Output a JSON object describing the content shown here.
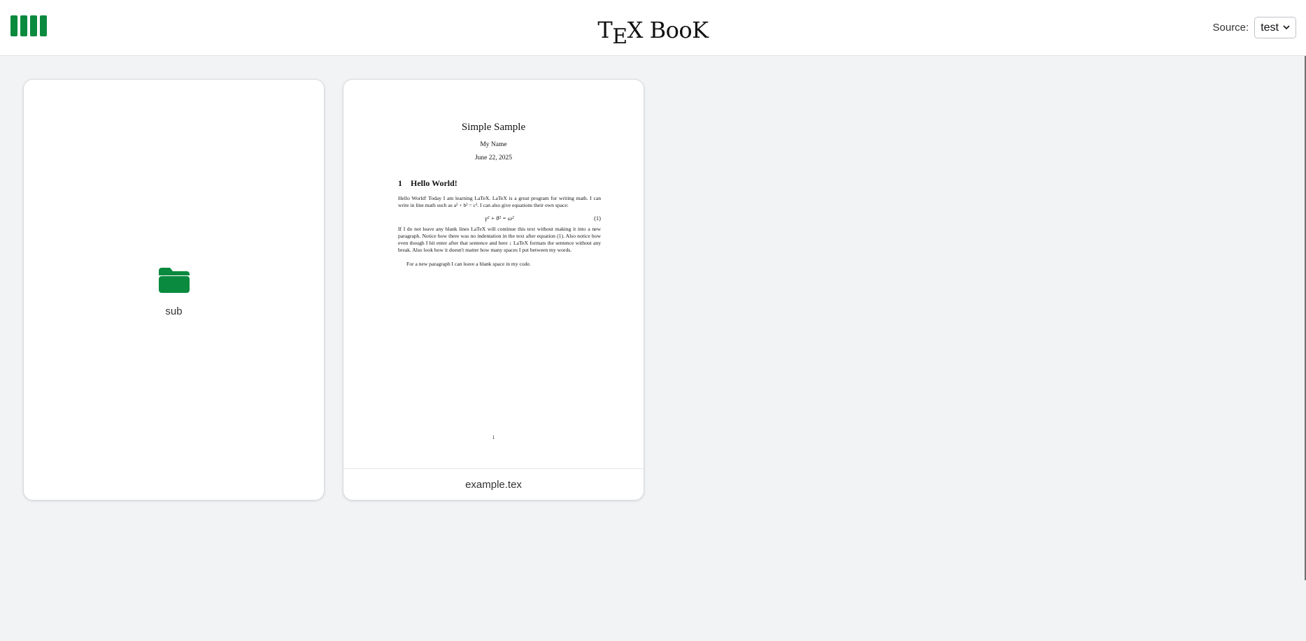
{
  "app": {
    "title_parts": {
      "t": "T",
      "e": "E",
      "x": "X",
      "book": "BooK"
    },
    "brand_color": "#0a8a3e"
  },
  "header": {
    "logo_icon": "bars-logo-icon",
    "source_label": "Source:",
    "source_selected": "test",
    "dropdown_icon": "chevron-down-icon"
  },
  "items": [
    {
      "type": "folder",
      "name": "sub",
      "icon": "folder-icon"
    },
    {
      "type": "file",
      "name": "example.tex",
      "preview": {
        "title": "Simple Sample",
        "author": "My Name",
        "date": "June 22, 2025",
        "section_number": "1",
        "section_title": "Hello World!",
        "para1": "Hello World! Today I am learning LaTeX. LaTeX is a great program for writing math. I can write in line math such as a² + b² = c². I can also give equations their own space:",
        "equation": "γ² + θ² = ω²",
        "equation_number": "(1)",
        "para2": "If I do not leave any blank lines LaTeX will continue this text without making it into a new paragraph. Notice how there was no indentation in the text after equation (1). Also notice how even though I hit enter after that sentence and here ↓ LaTeX formats the sentence without any break. Also look how it doesn't matter how many spaces I put between my words.",
        "para3": "For a new paragraph I can leave a blank space in my code.",
        "page_number": "1"
      }
    }
  ]
}
